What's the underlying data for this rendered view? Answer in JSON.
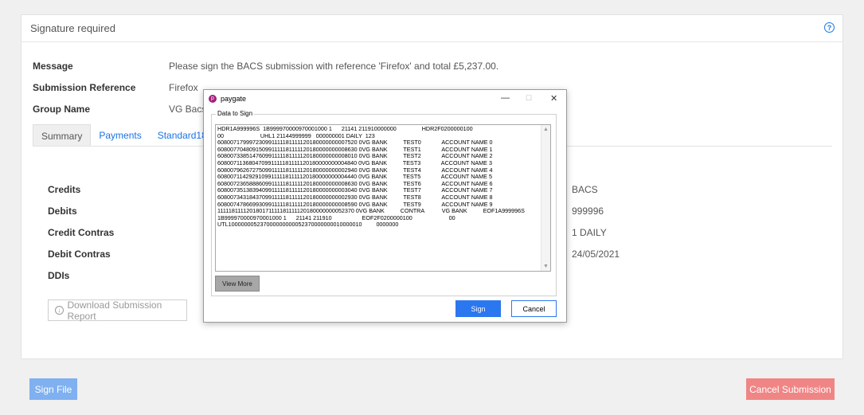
{
  "card": {
    "title": "Signature required",
    "help_icon": "help-circle-icon",
    "message_label": "Message",
    "message_value": "Please sign the BACS submission with reference 'Firefox' and total £5,237.00.",
    "submission_reference_label": "Submission Reference",
    "submission_reference_value": "Firefox",
    "group_name_label": "Group Name",
    "group_name_value": "VG Bacs"
  },
  "tabs": [
    {
      "label": "Summary",
      "active": true
    },
    {
      "label": "Payments",
      "active": false
    },
    {
      "label": "Standard18",
      "active": false
    }
  ],
  "summary": {
    "labels": [
      "Credits",
      "Debits",
      "Credit Contras",
      "Debit Contras",
      "DDIs"
    ],
    "values": [
      "BACS",
      "999996",
      "1 DAILY",
      "24/05/2021"
    ]
  },
  "download_button": {
    "label": "Download Submission Report",
    "icon": "download-circle-icon"
  },
  "sign_file_button": "Sign File",
  "cancel_submission_button": "Cancel Submission",
  "dialog": {
    "title": "paygate",
    "app_icon": "paygate-logo-icon",
    "minimize": "—",
    "maximize": "☐",
    "close": "✕",
    "group_label": "Data to Sign",
    "data_lines": "HDR1A999996S  1B999970000970001000 1      21141 211910000000                HDR2F0200000100\n00                       UHL1 21144999999   000000001 DAILY  123\n608007179997230991111181111120180000000007520 0VG BANK          TEST0             ACCOUNT NAME 0\n608007704809150991111181111120180000000008630 0VG BANK          TEST1             ACCOUNT NAME 1\n608007338514760991111181111120180000000008010 0VG BANK          TEST2             ACCOUNT NAME 2\n608007113680470991111181111120180000000004840 0VG BANK          TEST3             ACCOUNT NAME 3\n608007962672750991111181111120180000000002940 0VG BANK          TEST4             ACCOUNT NAME 4\n608007114292910991111181111120180000000004440 0VG BANK          TEST5             ACCOUNT NAME 5\n608007236588860991111181111120180000000008630 0VG BANK          TEST6             ACCOUNT NAME 6\n608007351383940991111181111120180000000003040 0VG BANK          TEST7             ACCOUNT NAME 7\n608007343184370991111181111120180000000002930 0VG BANK          TEST8             ACCOUNT NAME 8\n608007478669930991111181111120180000000008590 0VG BANK          TEST9             ACCOUNT NAME 9\n111118111120180171111181111120180000000052370 0VG BANK          CONTRA           VG BANK          EOF1A999996S\n1B999970000970001000 1      21141 211910                   EOF2F0200000100                       00\nUTL100000005237000000000052370000000010000010         0000000",
    "view_more": "View More",
    "sign": "Sign",
    "cancel": "Cancel"
  }
}
